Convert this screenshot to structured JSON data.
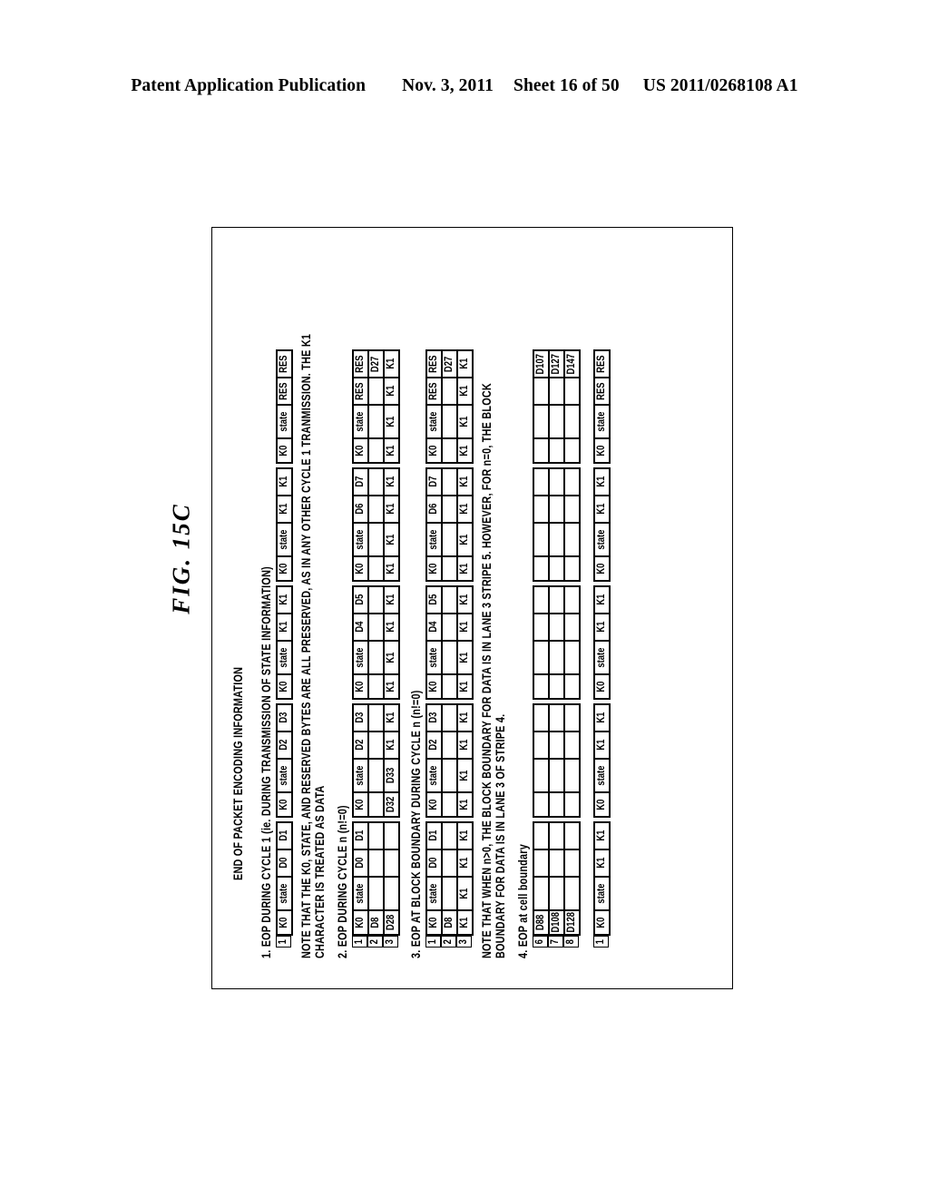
{
  "header": {
    "publication": "Patent Application Publication",
    "date": "Nov. 3, 2011",
    "sheet": "Sheet 16 of 50",
    "patent_number": "US 2011/0268108 A1"
  },
  "figure": {
    "label": "FIG. 15C",
    "title": "END OF PACKET ENCODING INFORMATION"
  },
  "sections": {
    "s1": {
      "heading": "1. EOP DURING CYCLE 1 (ie. DURING TRANSMISSION OF STATE INFORMATION)",
      "rows": [
        {
          "index": "1",
          "groups": [
            [
              "K0",
              "state",
              "D0",
              "D1"
            ],
            [
              "K0",
              "state",
              "D2",
              "D3"
            ],
            [
              "K0",
              "state",
              "K1",
              "K1"
            ],
            [
              "K0",
              "state",
              "K1",
              "K1"
            ],
            [
              "K0",
              "state",
              "RES",
              "RES"
            ]
          ]
        }
      ],
      "note": [
        "NOTE THAT THE K0, STATE, AND RESERVED BYTES ARE ALL PRESERVED, AS IN ANY OTHER CYCLE 1 TRANMISSION. THE K1",
        "CHARACTER IS TREATED AS DATA"
      ]
    },
    "s2": {
      "heading": "2. EOP DURING CYCLE n (n!=0)",
      "rows": [
        {
          "index": "1",
          "groups": [
            [
              "K0",
              "state",
              "D0",
              "D1"
            ],
            [
              "K0",
              "state",
              "D2",
              "D3"
            ],
            [
              "K0",
              "state",
              "D4",
              "D5"
            ],
            [
              "K0",
              "state",
              "D6",
              "D7"
            ],
            [
              "K0",
              "state",
              "RES",
              "RES"
            ]
          ]
        },
        {
          "index": "2",
          "groups": [
            [
              "D8",
              "",
              "",
              ""
            ],
            [
              "",
              "",
              "",
              ""
            ],
            [
              "",
              "",
              "",
              ""
            ],
            [
              "",
              "",
              "",
              ""
            ],
            [
              "",
              "",
              "",
              "D27"
            ]
          ]
        },
        {
          "index": "3",
          "groups": [
            [
              "D28",
              "",
              "",
              ""
            ],
            [
              "D32",
              "D33",
              "K1",
              "K1"
            ],
            [
              "K1",
              "K1",
              "K1",
              "K1"
            ],
            [
              "K1",
              "K1",
              "K1",
              "K1"
            ],
            [
              "K1",
              "K1",
              "K1",
              "K1"
            ]
          ]
        }
      ]
    },
    "s3": {
      "heading": "3. EOP AT BLOCK BOUNDARY DURING CYCLE n (n!=0)",
      "rows": [
        {
          "index": "1",
          "groups": [
            [
              "K0",
              "state",
              "D0",
              "D1"
            ],
            [
              "K0",
              "state",
              "D2",
              "D3"
            ],
            [
              "K0",
              "state",
              "D4",
              "D5"
            ],
            [
              "K0",
              "state",
              "D6",
              "D7"
            ],
            [
              "K0",
              "state",
              "RES",
              "RES"
            ]
          ]
        },
        {
          "index": "2",
          "groups": [
            [
              "D8",
              "",
              "",
              ""
            ],
            [
              "",
              "",
              "",
              ""
            ],
            [
              "",
              "",
              "",
              ""
            ],
            [
              "",
              "",
              "",
              ""
            ],
            [
              "",
              "",
              "",
              "D27"
            ]
          ]
        },
        {
          "index": "3",
          "groups": [
            [
              "K1",
              "K1",
              "K1",
              "K1"
            ],
            [
              "K1",
              "K1",
              "K1",
              "K1"
            ],
            [
              "K1",
              "K1",
              "K1",
              "K1"
            ],
            [
              "K1",
              "K1",
              "K1",
              "K1"
            ],
            [
              "K1",
              "K1",
              "K1",
              "K1"
            ]
          ]
        }
      ],
      "note": [
        "NOTE THAT WHEN n>0, THE BLOCK BOUNDARY FOR DATA IS IN LANE 3 STRIPE 5. HOWEVER, FOR n=0, THE BLOCK",
        "BOUNDARY FOR DATA IS IN LANE 3 OF STRIPE 4."
      ]
    },
    "s4": {
      "heading": "4. EOP at cell boundary",
      "rows": [
        {
          "index": "6",
          "groups": [
            [
              "D88",
              "",
              "",
              ""
            ],
            [
              "",
              "",
              "",
              ""
            ],
            [
              "",
              "",
              "",
              ""
            ],
            [
              "",
              "",
              "",
              ""
            ],
            [
              "",
              "",
              "",
              "D107"
            ]
          ]
        },
        {
          "index": "7",
          "groups": [
            [
              "D108",
              "",
              "",
              ""
            ],
            [
              "",
              "",
              "",
              ""
            ],
            [
              "",
              "",
              "",
              ""
            ],
            [
              "",
              "",
              "",
              ""
            ],
            [
              "",
              "",
              "",
              "D127"
            ]
          ]
        },
        {
          "index": "8",
          "groups": [
            [
              "D128",
              "",
              "",
              ""
            ],
            [
              "",
              "",
              "",
              ""
            ],
            [
              "",
              "",
              "",
              ""
            ],
            [
              "",
              "",
              "",
              ""
            ],
            [
              "",
              "",
              "",
              "D147"
            ]
          ]
        }
      ],
      "tail_rows": [
        {
          "index": "1",
          "groups": [
            [
              "K0",
              "state",
              "K1",
              "K1"
            ],
            [
              "K0",
              "state",
              "K1",
              "K1"
            ],
            [
              "K0",
              "state",
              "K1",
              "K1"
            ],
            [
              "K0",
              "state",
              "K1",
              "K1"
            ],
            [
              "K0",
              "state",
              "RES",
              "RES"
            ]
          ]
        }
      ]
    }
  }
}
